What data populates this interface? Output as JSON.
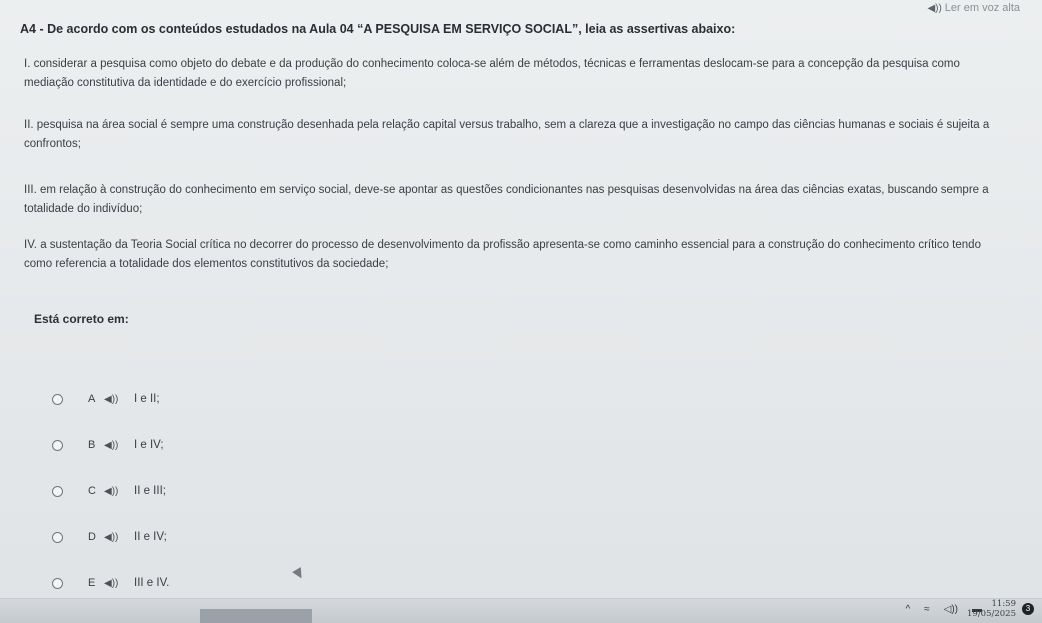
{
  "header": {
    "read_aloud_label": "Ler em voz alta",
    "read_aloud_icon": "speaker-icon"
  },
  "question": {
    "title": "A4 - De acordo com os conteúdos estudados na Aula 04 “A PESQUISA EM SERVIÇO SOCIAL”, leia as assertivas abaixo:",
    "assertions": [
      "I. considerar a pesquisa como objeto do debate e da produção do conhecimento coloca-se além de métodos, técnicas e ferramentas deslocam-se para a concepção da pesquisa como mediação constitutiva da identidade e do exercício profissional;",
      "II. pesquisa na área social é sempre uma construção desenhada pela relação capital versus trabalho, sem a clareza que a investigação no campo das ciências humanas e sociais é sujeita a confrontos;",
      "III. em relação à construção do conhecimento em serviço social, deve-se apontar as questões condicionantes nas pesquisas desenvolvidas na área das ciências exatas, buscando sempre a totalidade do indivíduo;",
      "IV. a sustentação da Teoria Social crítica no decorrer do processo de desenvolvimento da profissão apresenta-se como caminho essencial para a construção do conhecimento crítico tendo como referencia a totalidade dos elementos constitutivos da sociedade;"
    ],
    "prompt": "Está correto em:"
  },
  "options": [
    {
      "letter": "A",
      "speaker": "◀))",
      "text": "I e II;"
    },
    {
      "letter": "B",
      "speaker": "◀))",
      "text": "I e IV;"
    },
    {
      "letter": "C",
      "speaker": "◀))",
      "text": "II e III;"
    },
    {
      "letter": "D",
      "speaker": "◀))",
      "text": "II e IV;"
    },
    {
      "letter": "E",
      "speaker": "◀))",
      "text": "III e IV."
    }
  ],
  "taskbar": {
    "tray_icons": [
      "chevron-up-icon",
      "wifi-icon",
      "volume-icon",
      "battery-icon"
    ],
    "chevron": "^",
    "wifi": "≈",
    "volume": "◁))",
    "battery": "▬",
    "time": "11:59",
    "date": "19/05/2025",
    "notification": "3"
  }
}
